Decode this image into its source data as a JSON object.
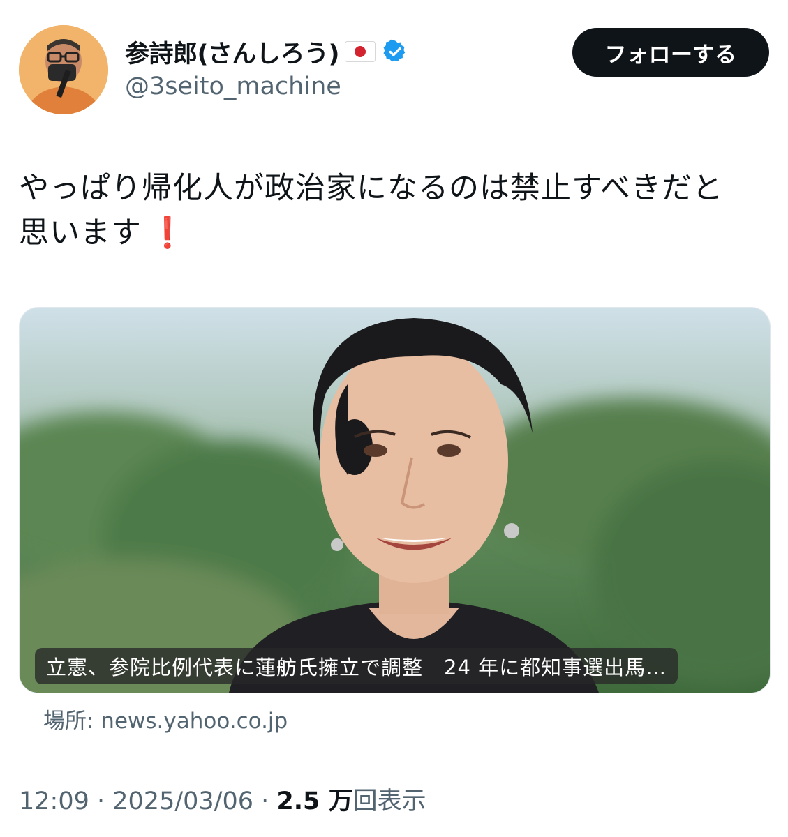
{
  "author": {
    "display_name": "参詩郎(さんしろう)",
    "handle": "@3seito_machine",
    "flag_icon": "japan-flag-icon",
    "verified_icon": "verified-badge-icon",
    "verified_color": "#1d9bf0"
  },
  "follow_button": {
    "label": "フォローする"
  },
  "tweet": {
    "line1": "やっぱり帰化人が政治家になるのは禁止すべきだと",
    "line2": "思います",
    "emoji": "❗"
  },
  "link_card": {
    "headline": "立憲、参院比例代表に蓮舫氏擁立で調整　24 年に都知事選出馬…",
    "source": "場所: news.yahoo.co.jp"
  },
  "meta": {
    "time": "12:09",
    "sep1": " · ",
    "date": "2025/03/06",
    "sep2": " · ",
    "views_count": "2.5 万",
    "views_label": "回表示"
  }
}
